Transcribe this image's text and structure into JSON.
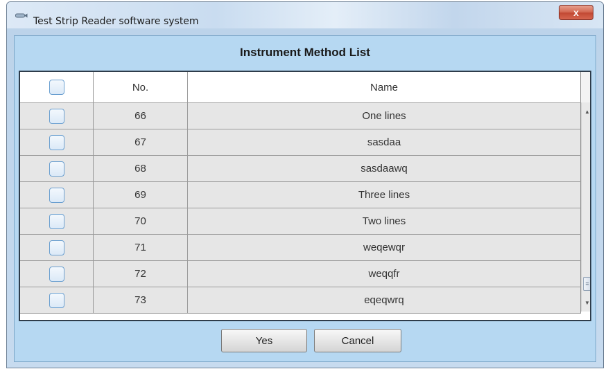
{
  "window": {
    "title": "Test Strip Reader software system",
    "close_label": "x"
  },
  "dialog": {
    "header": "Instrument Method List"
  },
  "table": {
    "columns": [
      "No.",
      "Name"
    ],
    "rows": [
      {
        "no": "66",
        "name": "One lines"
      },
      {
        "no": "67",
        "name": "sasdaa"
      },
      {
        "no": "68",
        "name": "sasdaawq"
      },
      {
        "no": "69",
        "name": "Three lines"
      },
      {
        "no": "70",
        "name": "Two lines"
      },
      {
        "no": "71",
        "name": "weqewqr"
      },
      {
        "no": "72",
        "name": "weqqfr"
      },
      {
        "no": "73",
        "name": "eqeqwrq"
      }
    ]
  },
  "buttons": {
    "yes": "Yes",
    "cancel": "Cancel"
  },
  "icons": {
    "window_icon": "app-icon",
    "scroll_up": "up-arrow-icon",
    "scroll_down": "down-arrow-icon",
    "scroll_grip": "grip-icon"
  }
}
